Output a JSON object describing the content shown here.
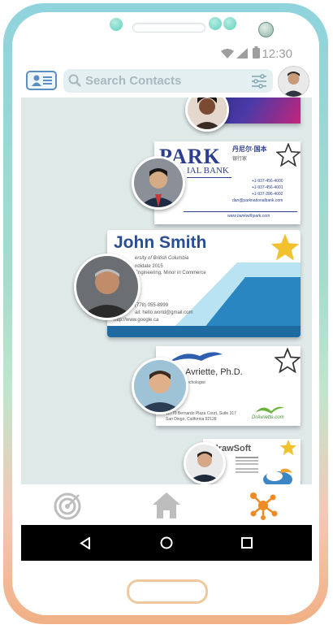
{
  "status_bar": {
    "time": "12:30"
  },
  "header": {
    "search_placeholder": "Search Contacts"
  },
  "cards": [
    {
      "company": "",
      "lines": []
    },
    {
      "logo": "PARK",
      "bank_fragment": "IAL BANK",
      "chinese_name": "丹尼尔·国本",
      "chinese_title": "银行家",
      "phone_lines": [
        "+1-937-456-4000",
        "+1-937-456-4001",
        "+1-937-286-4002"
      ],
      "email": "dan@parknationalbank.com",
      "website_line": "www.bankwithpark.com"
    },
    {
      "name": "John Smith",
      "university": "ersity of British Columbia",
      "grad": "ndidate 2015",
      "degree": "Engineering, Minor in Commerce",
      "phone": "(778) 055-8999",
      "email": "ail: hello.world@gmail.com",
      "website": "http://www.google.ca"
    },
    {
      "name": "Avriette, Ph.D.",
      "title": "sychologist",
      "address": "11770 Bernardo Plaza Court, Suite 317",
      "city": "San Diego, California 92128",
      "brand": "DrAvriette.com"
    },
    {
      "brand": "drawSoft"
    }
  ],
  "bottom_nav": {
    "items": [
      "target-icon",
      "home-icon",
      "network-icon"
    ]
  },
  "colors": {
    "accent_orange": "#f08a24",
    "nav_gray": "#bdbdbd",
    "star_gold": "#f2c12e",
    "card_blue": "#2a6fb0"
  }
}
